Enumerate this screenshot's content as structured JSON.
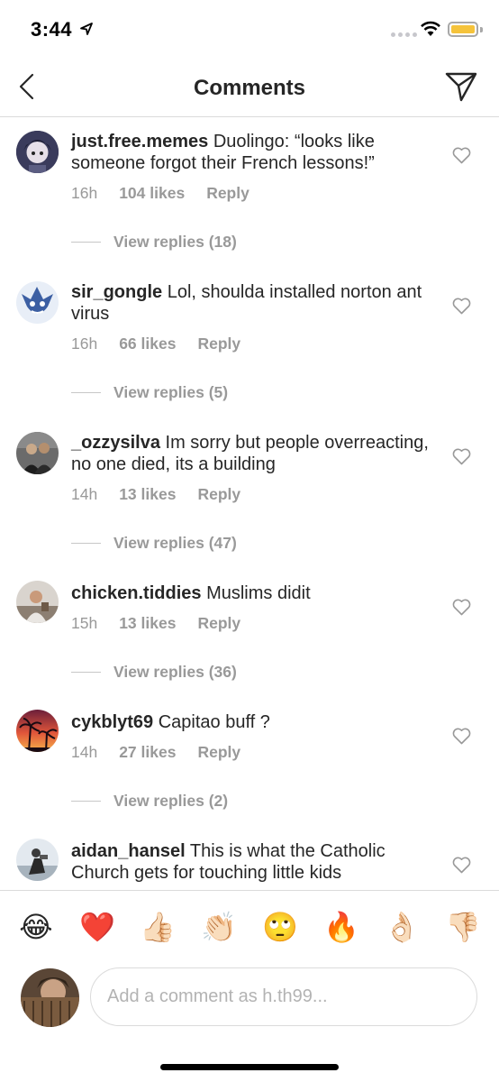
{
  "status_bar": {
    "time": "3:44",
    "battery_color": "#f5c33b"
  },
  "nav": {
    "title": "Comments",
    "back_icon": "chevron-left-icon",
    "send_icon": "paper-plane-icon"
  },
  "comments": [
    {
      "username": "just.free.memes",
      "text": "Duolingo: “looks like someone forgot their French lessons!”",
      "time": "16h",
      "likes": "104 likes",
      "reply": "Reply",
      "view_replies": "View replies (18)"
    },
    {
      "username": "sir_gongle",
      "text": "Lol, shoulda installed norton ant virus",
      "time": "16h",
      "likes": "66 likes",
      "reply": "Reply",
      "view_replies": "View replies (5)"
    },
    {
      "username": "_ozzysilva",
      "text": "Im sorry but people overreacting, no one died, its a building",
      "time": "14h",
      "likes": "13 likes",
      "reply": "Reply",
      "view_replies": "View replies (47)"
    },
    {
      "username": "chicken.tiddies",
      "text": "Muslims didit",
      "time": "15h",
      "likes": "13 likes",
      "reply": "Reply",
      "view_replies": "View replies (36)"
    },
    {
      "username": "cykblyt69",
      "text": "Capitao buff ?",
      "time": "14h",
      "likes": "27 likes",
      "reply": "Reply",
      "view_replies": "View replies (2)"
    },
    {
      "username": "aidan_hansel",
      "text": "This is what the Catholic Church gets for touching little kids"
    }
  ],
  "emoji_bar": [
    "😂",
    "❤️",
    "👍🏻",
    "👏🏻",
    "🙄",
    "🔥",
    "👌🏻",
    "👎🏻"
  ],
  "comment_input": {
    "placeholder": "Add a comment as h.th99..."
  }
}
